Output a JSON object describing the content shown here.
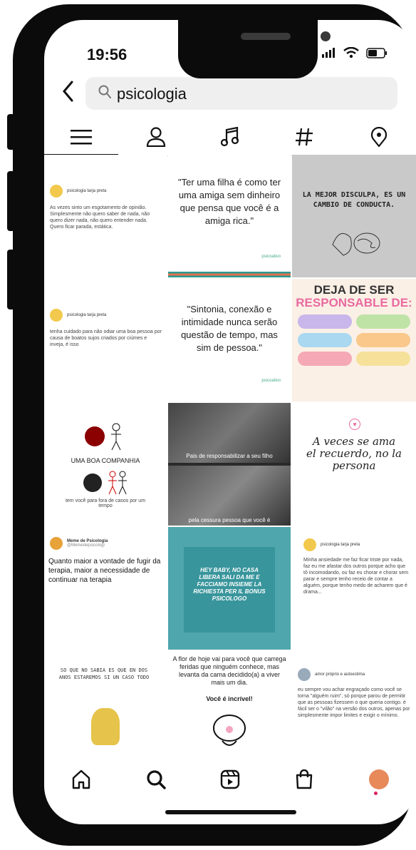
{
  "status": {
    "time": "19:56"
  },
  "search": {
    "query": "psicologia"
  },
  "tabs": [
    {
      "icon": "menu-icon"
    },
    {
      "icon": "person-icon"
    },
    {
      "icon": "music-icon"
    },
    {
      "icon": "hashtag-icon"
    },
    {
      "icon": "location-icon"
    }
  ],
  "posts": {
    "p1": {
      "name": "psicologia tarja preta",
      "text": "As vezes sinto um esgotamento de opinião. Simplesmente não quero saber de nada, não quero dizer nada, não quero entender nada. Quero ficar parada, estática."
    },
    "p2": {
      "quote": "\"Ter uma filha é como ter uma amiga sem dinheiro que pensa que você é a amiga rica.\"",
      "brand": "psicoativo"
    },
    "p3": {
      "text": "LA MEJOR DISCULPA, ES UN CAMBIO DE CONDUCTA."
    },
    "p4": {
      "name": "psicologia tarja preta",
      "text": "tenha cuidado para não odiar uma boa pessoa por causa de boatos sujos criados por ciúmes e inveja, é isso"
    },
    "p5": {
      "quote": "\"Sintonia, conexão e intimidade nunca serão questão de tempo, mas sim de pessoa.\"",
      "brand": "psicoativo"
    },
    "p6": {
      "title1": "DEJA DE SER",
      "title2": "RESPONSABLE DE:"
    },
    "p7": {
      "line1": "UMA BOA COMPANHIA",
      "line2": "tem você para fora de casos por um tempo"
    },
    "p8": {
      "top": "Pais de responsabilizar a seu filho",
      "bottom": "pela cessura pessoa que você é"
    },
    "p9": {
      "text": "A veces se ama el recuerdo, no la persona"
    },
    "p10": {
      "name": "Meme de Psicologia",
      "handle": "@Memedepsicologi",
      "text": "Quanto maior a vontade de fugir da terapia, maior a necessidade de continuar na terapia"
    },
    "p11": {
      "text": "HEY BABY, NO CASA LIBERA SALI DA ME E FACCIAMO INSIEME LA RICHIESTA PER IL BONUS PSICOLOGO"
    },
    "p12": {
      "name": "psicologia tarja preta",
      "text": "Minha ansiedade me faz ficar triste por nada, faz eu me afastar dos outros porque acho que tô incomodando, ou faz eu chorar e chorar sem parar e sempre tenho receio de contar a alguém, porque tenho medo de acharem que é drama..."
    },
    "p13": {
      "text": "SO QUE NO SABIA ES QUE EN DOS ANOS ESTAREMOS SI UN CASO TODO"
    },
    "p14": {
      "text": "A flor de hoje vai para você que carrega feridas que ninguém conhece, mas levanta da cama decidido(a) a viver mais um dia.",
      "sub": "Você é incrível!"
    },
    "p15": {
      "name": "amor próprio e autoestima",
      "text": "eu sempre vou achar engraçado como você se torna \"alguém ruim\", só porque parou de permitir que as pessoas fizessem o que queria contigo. é fácil ser o \"vilão\" na versão dos outros, apenas por simplesmente impor limites e exigir o mínimo."
    }
  },
  "bottom_nav": [
    {
      "icon": "home-icon"
    },
    {
      "icon": "search-icon"
    },
    {
      "icon": "reels-icon"
    },
    {
      "icon": "shop-icon"
    },
    {
      "icon": "profile-avatar"
    }
  ]
}
